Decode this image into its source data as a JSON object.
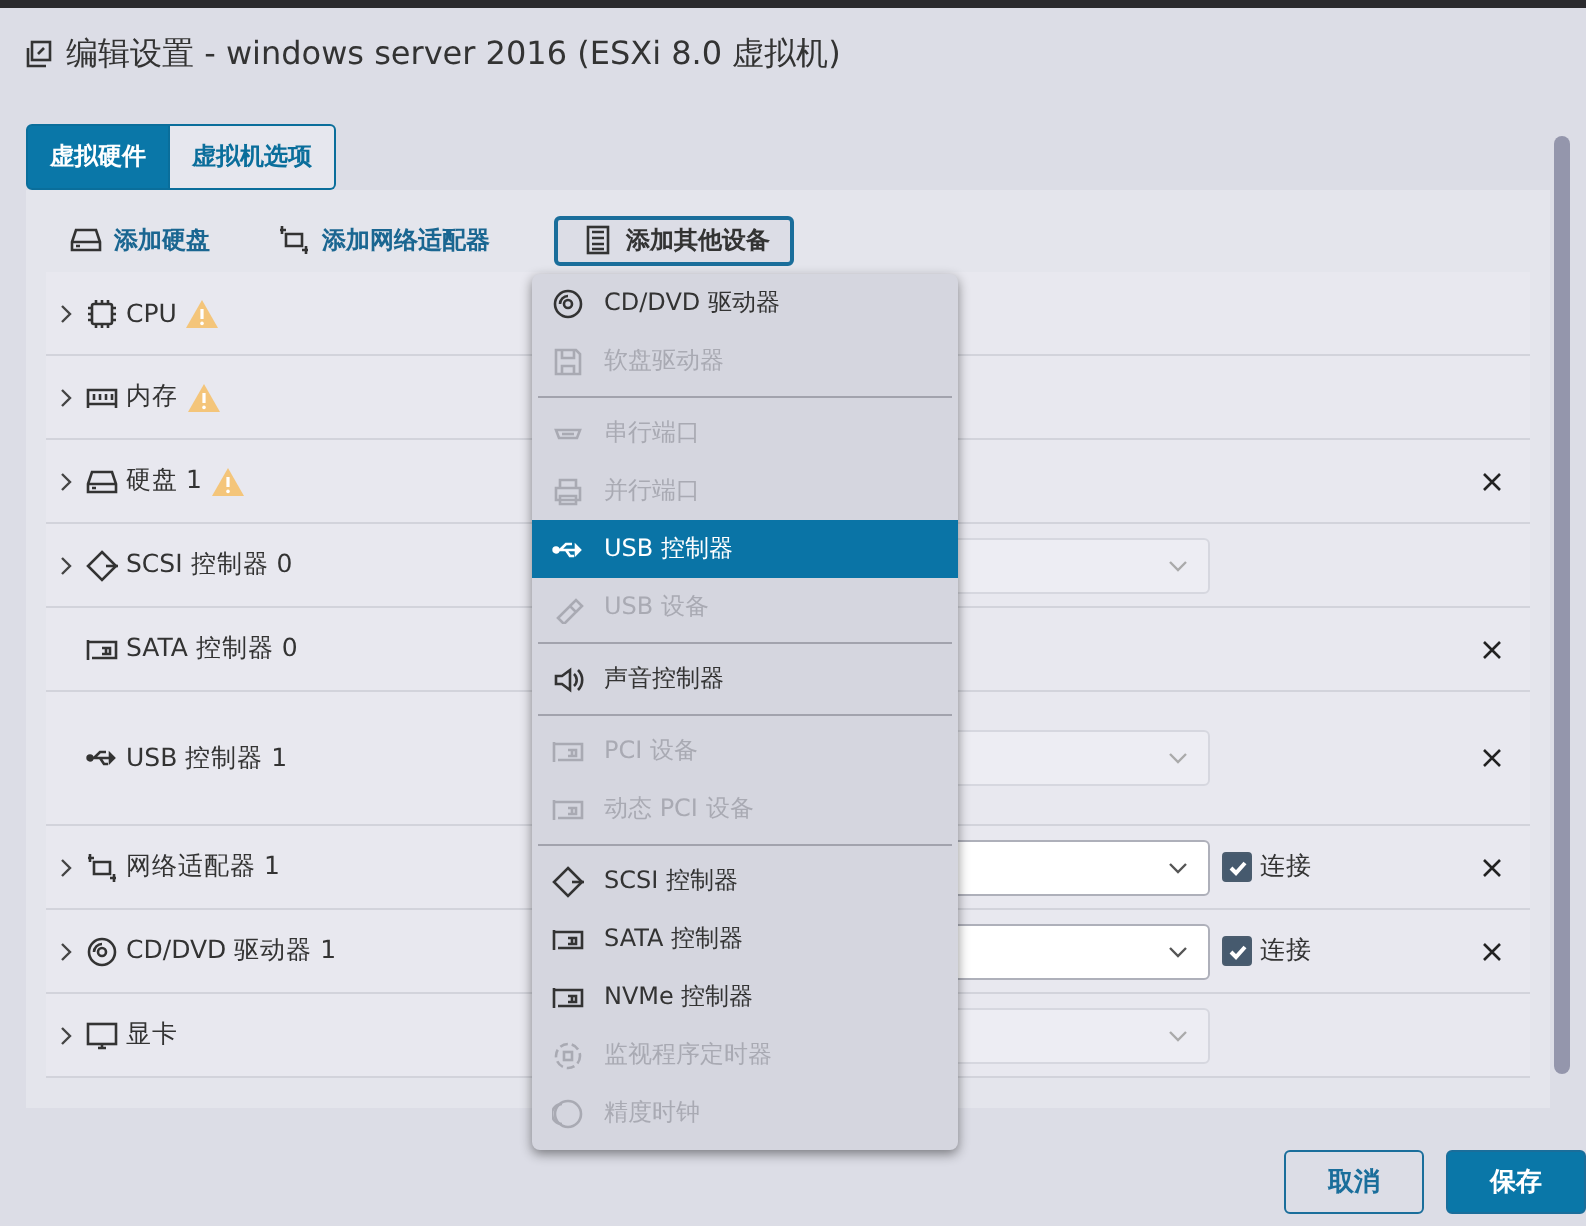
{
  "window": {
    "title": "编辑设置 - windows server 2016 (ESXi 8.0 虚拟机)"
  },
  "tabs": [
    {
      "label": "虚拟硬件",
      "selected": true
    },
    {
      "label": "虚拟机选项",
      "selected": false
    }
  ],
  "toolbar": [
    {
      "label": "添加硬盘",
      "kind": "disk",
      "outlined": false
    },
    {
      "label": "添加网络适配器",
      "kind": "network",
      "outlined": false
    },
    {
      "label": "添加其他设备",
      "kind": "list",
      "outlined": true
    }
  ],
  "rows": [
    {
      "label": "CPU",
      "kind": "cpu",
      "expandable": true,
      "warning": true,
      "removable": false
    },
    {
      "label": "内存",
      "kind": "memory",
      "expandable": true,
      "warning": true,
      "removable": false
    },
    {
      "label": "硬盘 1",
      "kind": "disk",
      "expandable": true,
      "warning": true,
      "removable": true
    },
    {
      "label": "SCSI 控制器 0",
      "kind": "scsi",
      "expandable": true,
      "warning": false,
      "removable": false,
      "field": {
        "disabled": true
      }
    },
    {
      "label": "SATA 控制器 0",
      "kind": "card",
      "expandable": false,
      "warning": false,
      "removable": true
    },
    {
      "label": "USB 控制器 1",
      "kind": "usb",
      "expandable": false,
      "warning": false,
      "removable": true,
      "field": {
        "disabled": true
      }
    },
    {
      "label": "网络适配器 1",
      "kind": "network",
      "expandable": true,
      "warning": false,
      "removable": true,
      "field": {
        "disabled": false
      },
      "connect": {
        "label": "连接",
        "checked": true
      }
    },
    {
      "label": "CD/DVD 驱动器 1",
      "kind": "cd",
      "expandable": true,
      "warning": false,
      "removable": true,
      "field": {
        "disabled": false
      },
      "connect": {
        "label": "连接",
        "checked": true
      }
    },
    {
      "label": "显卡",
      "kind": "monitor",
      "expandable": true,
      "warning": false,
      "removable": false,
      "field": {
        "disabled": true
      }
    }
  ],
  "menu": [
    {
      "kind": "cd",
      "label": "CD/DVD 驱动器",
      "disabled": false,
      "selected": false
    },
    {
      "kind": "floppy",
      "label": "软盘驱动器",
      "disabled": true,
      "selected": false
    },
    {
      "kind": "separator"
    },
    {
      "kind": "serial",
      "label": "串行端口",
      "disabled": true,
      "selected": false
    },
    {
      "kind": "printer",
      "label": "并行端口",
      "disabled": true,
      "selected": false
    },
    {
      "kind": "usb",
      "label": "USB 控制器",
      "disabled": false,
      "selected": true
    },
    {
      "kind": "usbstick",
      "label": "USB 设备",
      "disabled": true,
      "selected": false
    },
    {
      "kind": "separator"
    },
    {
      "kind": "speaker",
      "label": "声音控制器",
      "disabled": false,
      "selected": false
    },
    {
      "kind": "separator"
    },
    {
      "kind": "card",
      "label": "PCI 设备",
      "disabled": true,
      "selected": false
    },
    {
      "kind": "card",
      "label": "动态 PCI 设备",
      "disabled": true,
      "selected": false
    },
    {
      "kind": "separator"
    },
    {
      "kind": "scsi",
      "label": "SCSI 控制器",
      "disabled": false,
      "selected": false
    },
    {
      "kind": "card",
      "label": "SATA 控制器",
      "disabled": false,
      "selected": false
    },
    {
      "kind": "card",
      "label": "NVMe 控制器",
      "disabled": false,
      "selected": false
    },
    {
      "kind": "watchdog",
      "label": "监视程序定时器",
      "disabled": true,
      "selected": false
    },
    {
      "kind": "clock",
      "label": "精度时钟",
      "disabled": true,
      "selected": false
    }
  ],
  "buttons": [
    {
      "label": "取消",
      "kind": "secondary"
    },
    {
      "label": "保存",
      "kind": "primary"
    }
  ]
}
